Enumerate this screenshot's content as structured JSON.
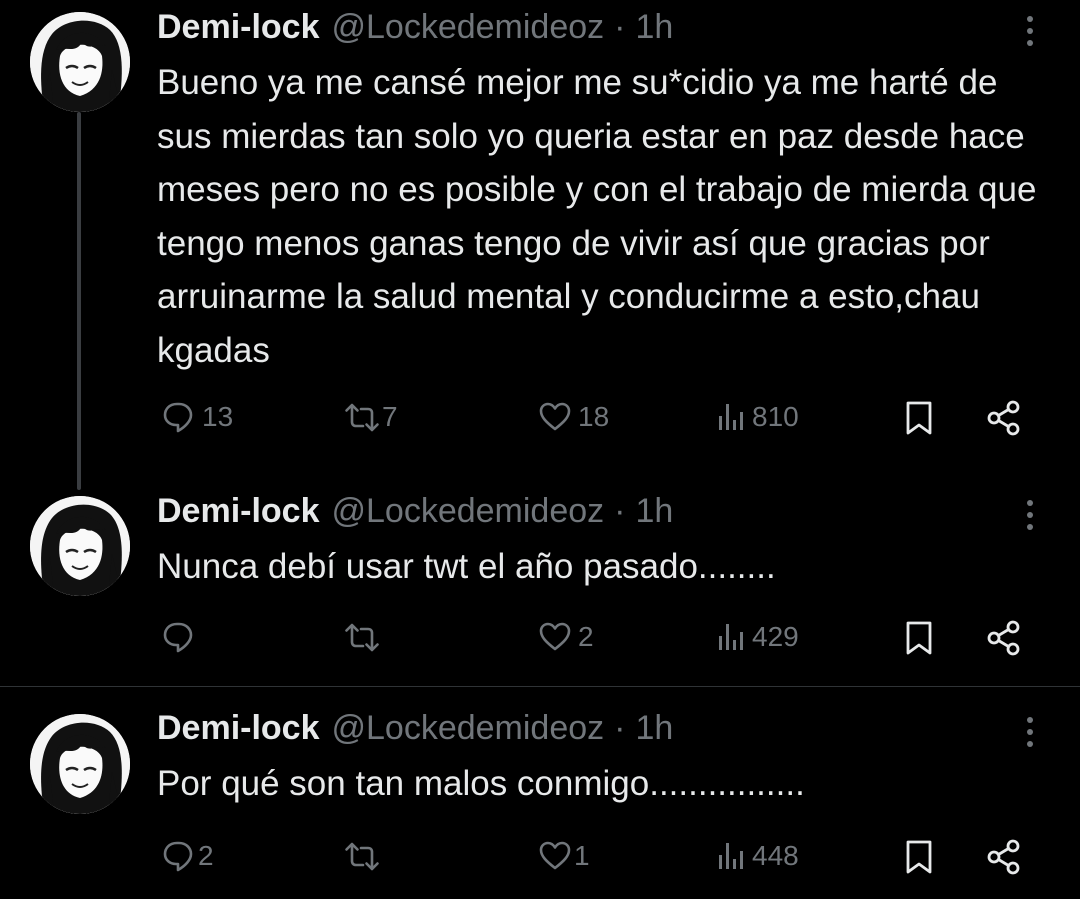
{
  "colors": {
    "background": "#000000",
    "text": "#e7e9ea",
    "muted": "#71767b",
    "thread_line": "#3a3d41"
  },
  "tweets": [
    {
      "name": "Demi-lock",
      "handle": "@Lockedemideoz",
      "sep": "·",
      "time": "1h",
      "text": "Bueno ya me cansé mejor me su*cidio ya me harté de sus mierdas tan solo yo queria estar en paz desde hace meses pero no es posible y con el trabajo de mierda que tengo menos ganas tengo de vivir así que gracias por arruinarme la salud mental y conducirme a esto,chau kgadas",
      "replies": "13",
      "retweets": "7",
      "likes": "18",
      "views": "810"
    },
    {
      "name": "Demi-lock",
      "handle": "@Lockedemideoz",
      "sep": "·",
      "time": "1h",
      "text": "Nunca debí usar twt el año pasado........",
      "replies": "",
      "retweets": "",
      "likes": "2",
      "views": "429"
    },
    {
      "name": "Demi-lock",
      "handle": "@Lockedemideoz",
      "sep": "·",
      "time": "1h",
      "text": "Por qué son tan malos conmigo................",
      "replies": "2",
      "retweets": "",
      "likes": "1",
      "views": "448"
    }
  ],
  "icons": [
    "reply-icon",
    "retweet-icon",
    "like-icon",
    "views-icon",
    "bookmark-icon",
    "share-icon",
    "more-icon"
  ]
}
